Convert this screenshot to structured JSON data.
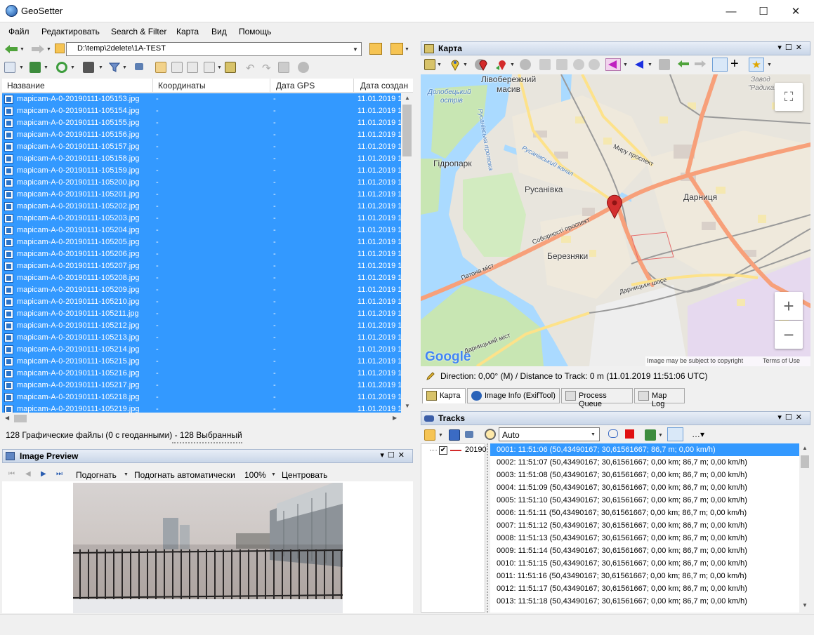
{
  "window": {
    "title": "GeoSetter",
    "minimize": "—",
    "maximize": "☐",
    "close": "✕"
  },
  "menu": [
    "Файл",
    "Редактировать",
    "Search & Filter",
    "Карта",
    "Вид",
    "Помощь"
  ],
  "path": {
    "value": "D:\\temp\\2delete\\1A-TEST"
  },
  "table": {
    "columns": [
      "Название",
      "Координаты",
      "Дата GPS",
      "Дата создан"
    ],
    "rows": [
      [
        "mapicam-A-0-20190111-105153.jpg",
        "-",
        "-",
        "11.01.2019 1"
      ],
      [
        "mapicam-A-0-20190111-105154.jpg",
        "-",
        "-",
        "11.01.2019 1"
      ],
      [
        "mapicam-A-0-20190111-105155.jpg",
        "-",
        "-",
        "11.01.2019 1"
      ],
      [
        "mapicam-A-0-20190111-105156.jpg",
        "-",
        "-",
        "11.01.2019 1"
      ],
      [
        "mapicam-A-0-20190111-105157.jpg",
        "-",
        "-",
        "11.01.2019 1"
      ],
      [
        "mapicam-A-0-20190111-105158.jpg",
        "-",
        "-",
        "11.01.2019 1"
      ],
      [
        "mapicam-A-0-20190111-105159.jpg",
        "-",
        "-",
        "11.01.2019 1"
      ],
      [
        "mapicam-A-0-20190111-105200.jpg",
        "-",
        "-",
        "11.01.2019 1"
      ],
      [
        "mapicam-A-0-20190111-105201.jpg",
        "-",
        "-",
        "11.01.2019 1"
      ],
      [
        "mapicam-A-0-20190111-105202.jpg",
        "-",
        "-",
        "11.01.2019 1"
      ],
      [
        "mapicam-A-0-20190111-105203.jpg",
        "-",
        "-",
        "11.01.2019 1"
      ],
      [
        "mapicam-A-0-20190111-105204.jpg",
        "-",
        "-",
        "11.01.2019 1"
      ],
      [
        "mapicam-A-0-20190111-105205.jpg",
        "-",
        "-",
        "11.01.2019 1"
      ],
      [
        "mapicam-A-0-20190111-105206.jpg",
        "-",
        "-",
        "11.01.2019 1"
      ],
      [
        "mapicam-A-0-20190111-105207.jpg",
        "-",
        "-",
        "11.01.2019 1"
      ],
      [
        "mapicam-A-0-20190111-105208.jpg",
        "-",
        "-",
        "11.01.2019 1"
      ],
      [
        "mapicam-A-0-20190111-105209.jpg",
        "-",
        "-",
        "11.01.2019 1"
      ],
      [
        "mapicam-A-0-20190111-105210.jpg",
        "-",
        "-",
        "11.01.2019 1"
      ],
      [
        "mapicam-A-0-20190111-105211.jpg",
        "-",
        "-",
        "11.01.2019 1"
      ],
      [
        "mapicam-A-0-20190111-105212.jpg",
        "-",
        "-",
        "11.01.2019 1"
      ],
      [
        "mapicam-A-0-20190111-105213.jpg",
        "-",
        "-",
        "11.01.2019 1"
      ],
      [
        "mapicam-A-0-20190111-105214.jpg",
        "-",
        "-",
        "11.01.2019 1"
      ],
      [
        "mapicam-A-0-20190111-105215.jpg",
        "-",
        "-",
        "11.01.2019 1"
      ],
      [
        "mapicam-A-0-20190111-105216.jpg",
        "-",
        "-",
        "11.01.2019 1"
      ],
      [
        "mapicam-A-0-20190111-105217.jpg",
        "-",
        "-",
        "11.01.2019 1"
      ],
      [
        "mapicam-A-0-20190111-105218.jpg",
        "-",
        "-",
        "11.01.2019 1"
      ],
      [
        "mapicam-A-0-20190111-105219.jpg",
        "-",
        "-",
        "11.01.2019 1"
      ]
    ]
  },
  "status": {
    "text": "128 Графические файлы   (0 с геоданными)  - 128 Выбранный"
  },
  "preview": {
    "title": "Image Preview",
    "fit": "Подогнать",
    "fit_auto": "Подогнать автоматически",
    "zoom": "100%",
    "center": "Центровать"
  },
  "map_panel": {
    "title": "Карта",
    "labels": {
      "livoberezhny": "Лівобережний",
      "masyv": "масив",
      "dolobetsky": "Долобецький",
      "ostriv": "острів",
      "hidropark": "Гідропарк",
      "rusanivka": "Русанівка",
      "darnytsia": "Дарниця",
      "bereznyaky": "Березняки",
      "zavod": "Завод",
      "radyka": "\"Радика...",
      "myru": "Миру проспект",
      "soborn": "Соборності проспект",
      "patona": "Патона міст",
      "darnytske": "Дарницьке шосе",
      "rusanivsky_kanal": "Русанівський канал",
      "rusanivska_protoka": "Русанівська протока",
      "darnytsky_mist": "Дарницький міст"
    },
    "google": "Google",
    "copyright": "Image may be subject to copyright",
    "terms": "Terms of Use",
    "zoom_in": "+",
    "zoom_out": "−",
    "fullscreen": "⛶",
    "direction": "Direction: 0,00° (M) / Distance to Track: 0 m (11.01.2019 11:51:06 UTC)"
  },
  "tabs": [
    "Карта",
    "Image Info (ExifTool)",
    "Process Queue",
    "Map Log"
  ],
  "tracks": {
    "title": "Tracks",
    "select_value": "Auto",
    "tree_item": "20190",
    "rows": [
      "0001: 11:51:06 (50,43490167; 30,61561667; 86,7 m; 0,00 km/h)",
      "0002: 11:51:07 (50,43490167; 30,61561667; 0,00 km; 86,7 m; 0,00 km/h)",
      "0003: 11:51:08 (50,43490167; 30,61561667; 0,00 km; 86,7 m; 0,00 km/h)",
      "0004: 11:51:09 (50,43490167; 30,61561667; 0,00 km; 86,7 m; 0,00 km/h)",
      "0005: 11:51:10 (50,43490167; 30,61561667; 0,00 km; 86,7 m; 0,00 km/h)",
      "0006: 11:51:11 (50,43490167; 30,61561667; 0,00 km; 86,7 m; 0,00 km/h)",
      "0007: 11:51:12 (50,43490167; 30,61561667; 0,00 km; 86,7 m; 0,00 km/h)",
      "0008: 11:51:13 (50,43490167; 30,61561667; 0,00 km; 86,7 m; 0,00 km/h)",
      "0009: 11:51:14 (50,43490167; 30,61561667; 0,00 km; 86,7 m; 0,00 km/h)",
      "0010: 11:51:15 (50,43490167; 30,61561667; 0,00 km; 86,7 m; 0,00 km/h)",
      "0011: 11:51:16 (50,43490167; 30,61561667; 0,00 km; 86,7 m; 0,00 km/h)",
      "0012: 11:51:17 (50,43490167; 30,61561667; 0,00 km; 86,7 m; 0,00 km/h)",
      "0013: 11:51:18 (50,43490167; 30,61561667; 0,00 km; 86,7 m; 0,00 km/h)"
    ]
  },
  "colors": {
    "selection": "#3399ff",
    "panel_header": "#c9d6e8"
  }
}
